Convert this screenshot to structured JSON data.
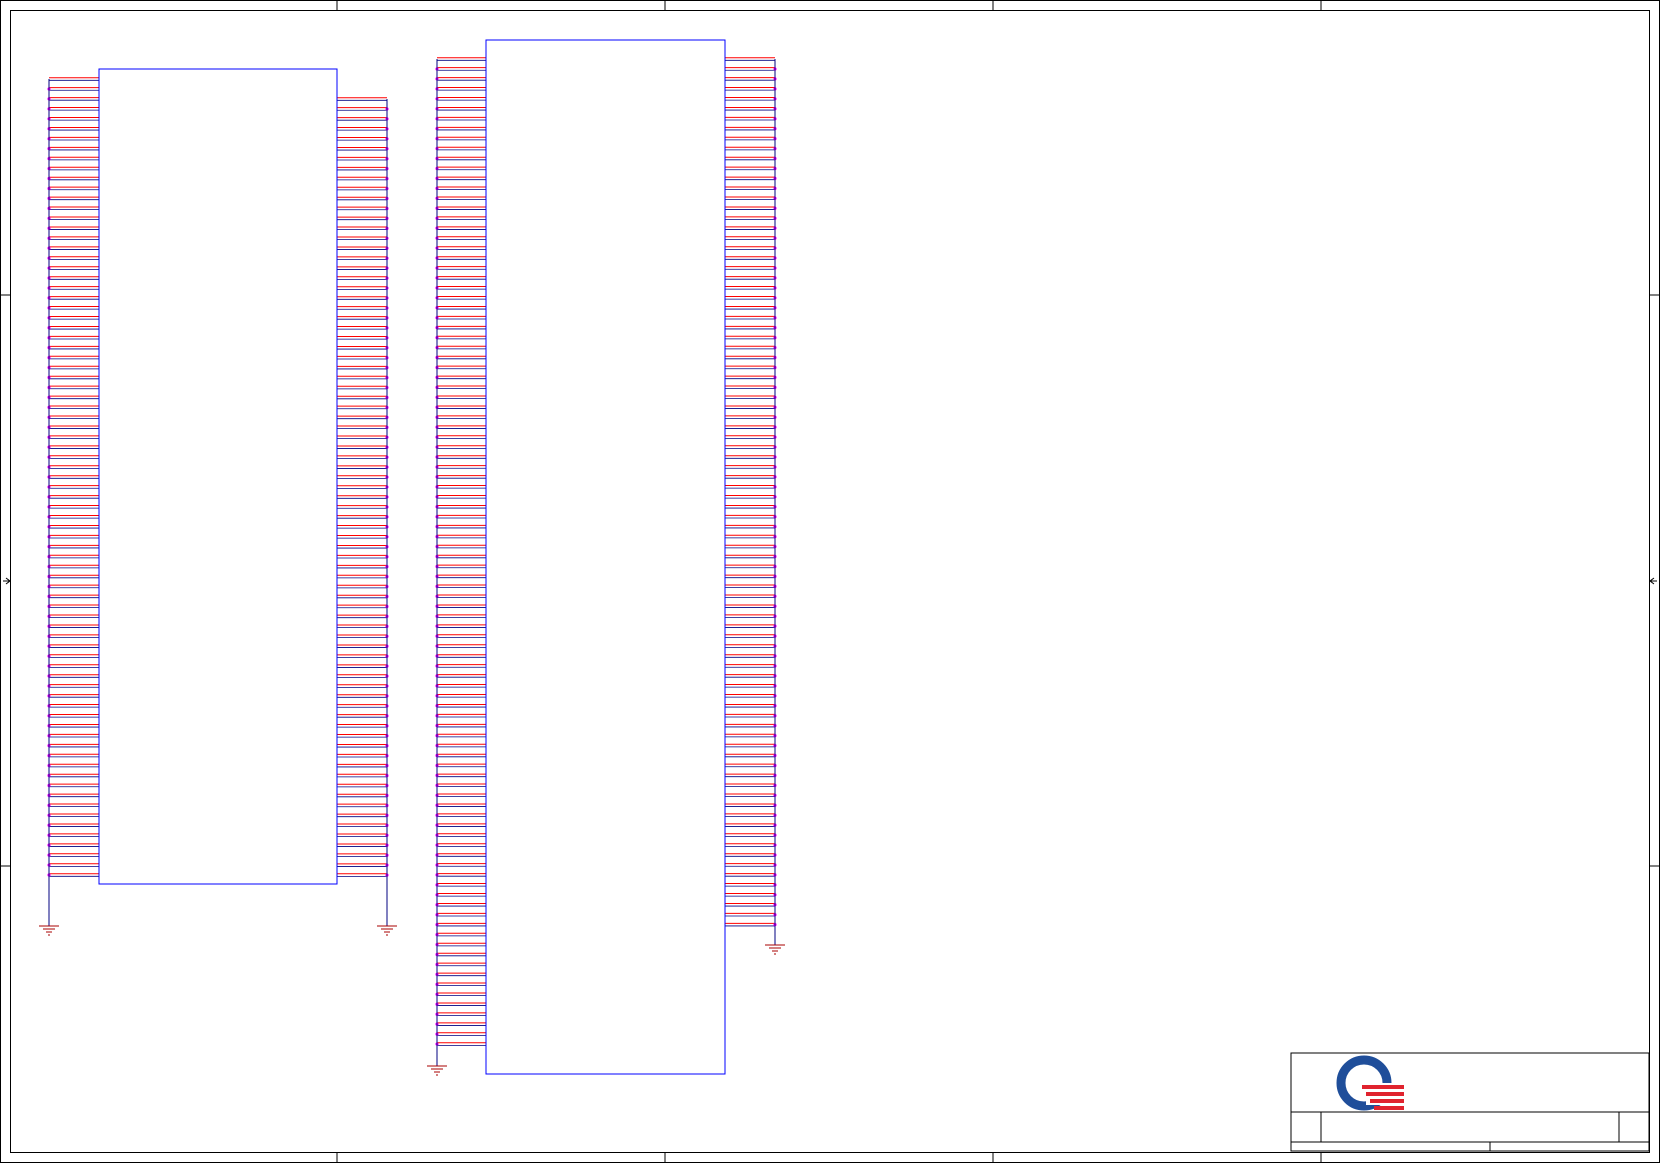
{
  "sheet": {
    "title": "",
    "colors": {
      "frame": "#000000",
      "component_outline": "#0000ff",
      "pin": "#ff0000",
      "net_wire": "#000080",
      "junction": "#ff00ff",
      "ground": "#aa0000",
      "logo_blue": "#1f4e9a",
      "logo_red": "#e0232e"
    }
  },
  "components": [
    {
      "name": "connector-left",
      "left_pins": 81,
      "right_pins": 79
    },
    {
      "name": "connector-right",
      "left_pins": 100,
      "right_pins": 88
    }
  ],
  "title_block": {
    "logo": "company-logo",
    "title": "",
    "doc_number": "",
    "revision": "",
    "date": "",
    "sheet_info": ""
  }
}
